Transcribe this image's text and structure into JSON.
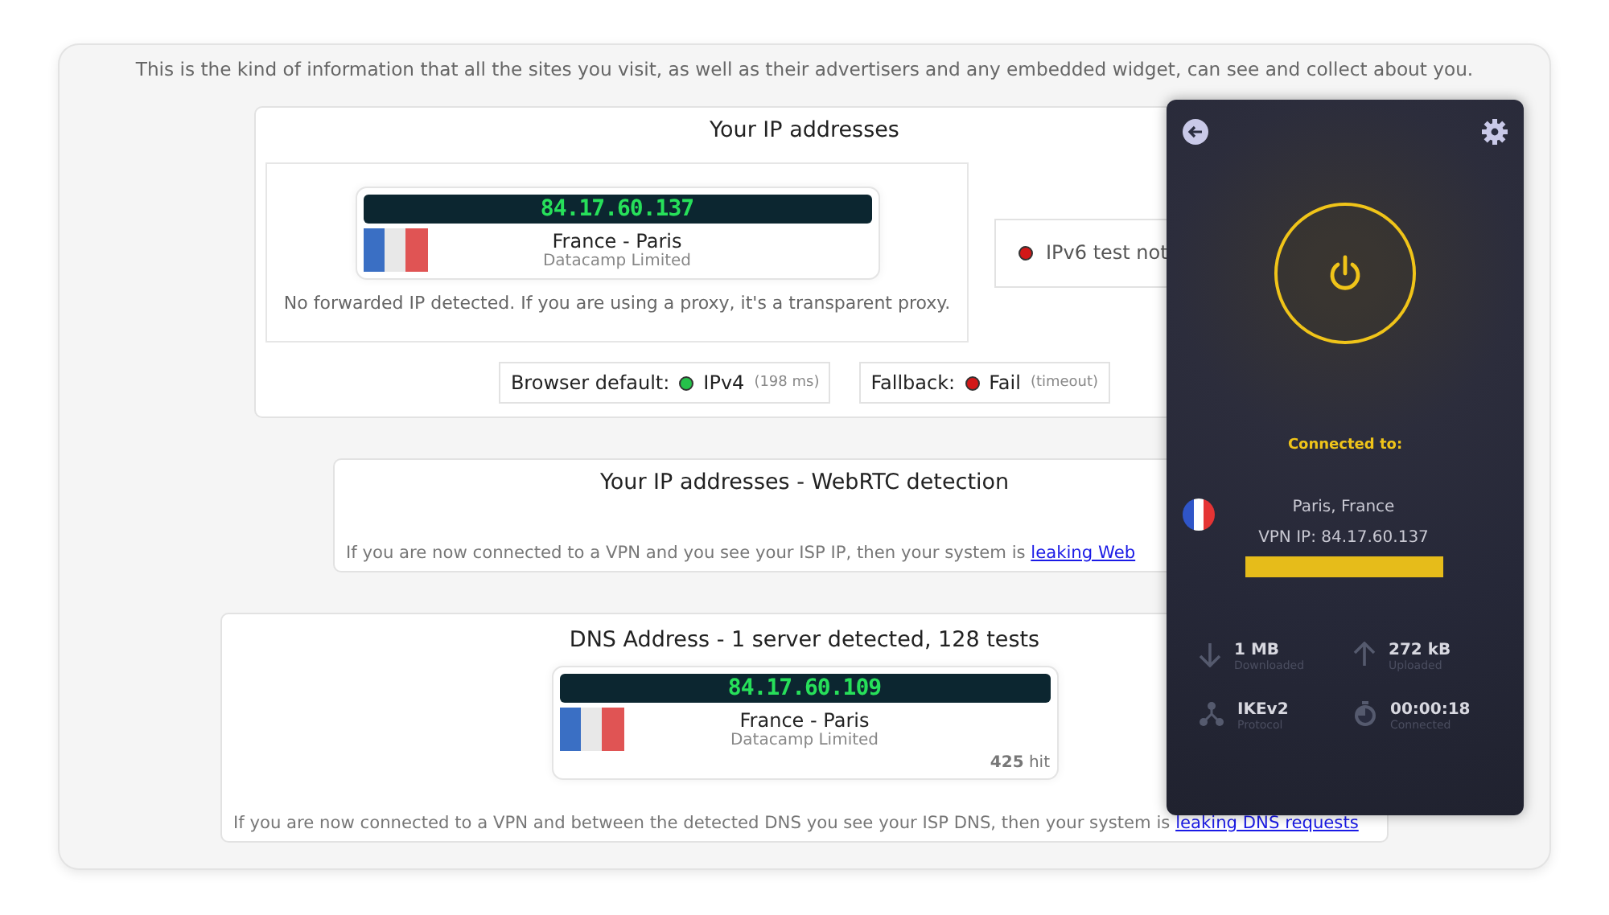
{
  "intro": "This is the kind of information that all the sites you visit, as well as their advertisers and any embedded widget, can see and collect about you.",
  "ip_section": {
    "title": "Your IP addresses",
    "address": {
      "ip": "84.17.60.137",
      "location": "France - Paris",
      "org": "Datacamp Limited"
    },
    "note": "No forwarded IP detected. If you are using a proxy, it's a transparent proxy.",
    "ipv6": {
      "ok": false,
      "text": "IPv6 test not"
    },
    "checks": [
      {
        "label": "Browser default:",
        "ok": true,
        "value": "IPv4",
        "detail": "(198 ms)"
      },
      {
        "label": "Fallback:",
        "ok": false,
        "value": "Fail",
        "detail": "(timeout)"
      }
    ]
  },
  "webrtc_section": {
    "title": "Your IP addresses - WebRTC detection",
    "note": "If you are now connected to a VPN and you see your ISP IP, then your system is",
    "link": "leaking Web"
  },
  "dns_section": {
    "title": "DNS Address - 1 server detected, 128 tests",
    "address": {
      "ip": "84.17.60.109",
      "location": "France - Paris",
      "org": "Datacamp Limited",
      "hits": "**425** hit"
    },
    "note": "If you are now connected to a VPN and between the detected DNS you see your ISP DNS, then your system is",
    "link": "leaking DNS requests"
  },
  "vpn": {
    "connected": true,
    "status_label": "Connected to:",
    "location": "Paris, France",
    "vpn_ip": "VPN IP: 84.17.60.137",
    "stats": [
      {
        "kind": "download",
        "value": "1 MB",
        "label": "Downloaded"
      },
      {
        "kind": "upload",
        "value": "272 kB",
        "label": "Uploaded"
      },
      {
        "kind": "protocol",
        "value": "IKEv2",
        "label": "Protocol"
      },
      {
        "kind": "timer",
        "value": "00:00:18",
        "label": "Connected"
      }
    ]
  }
}
